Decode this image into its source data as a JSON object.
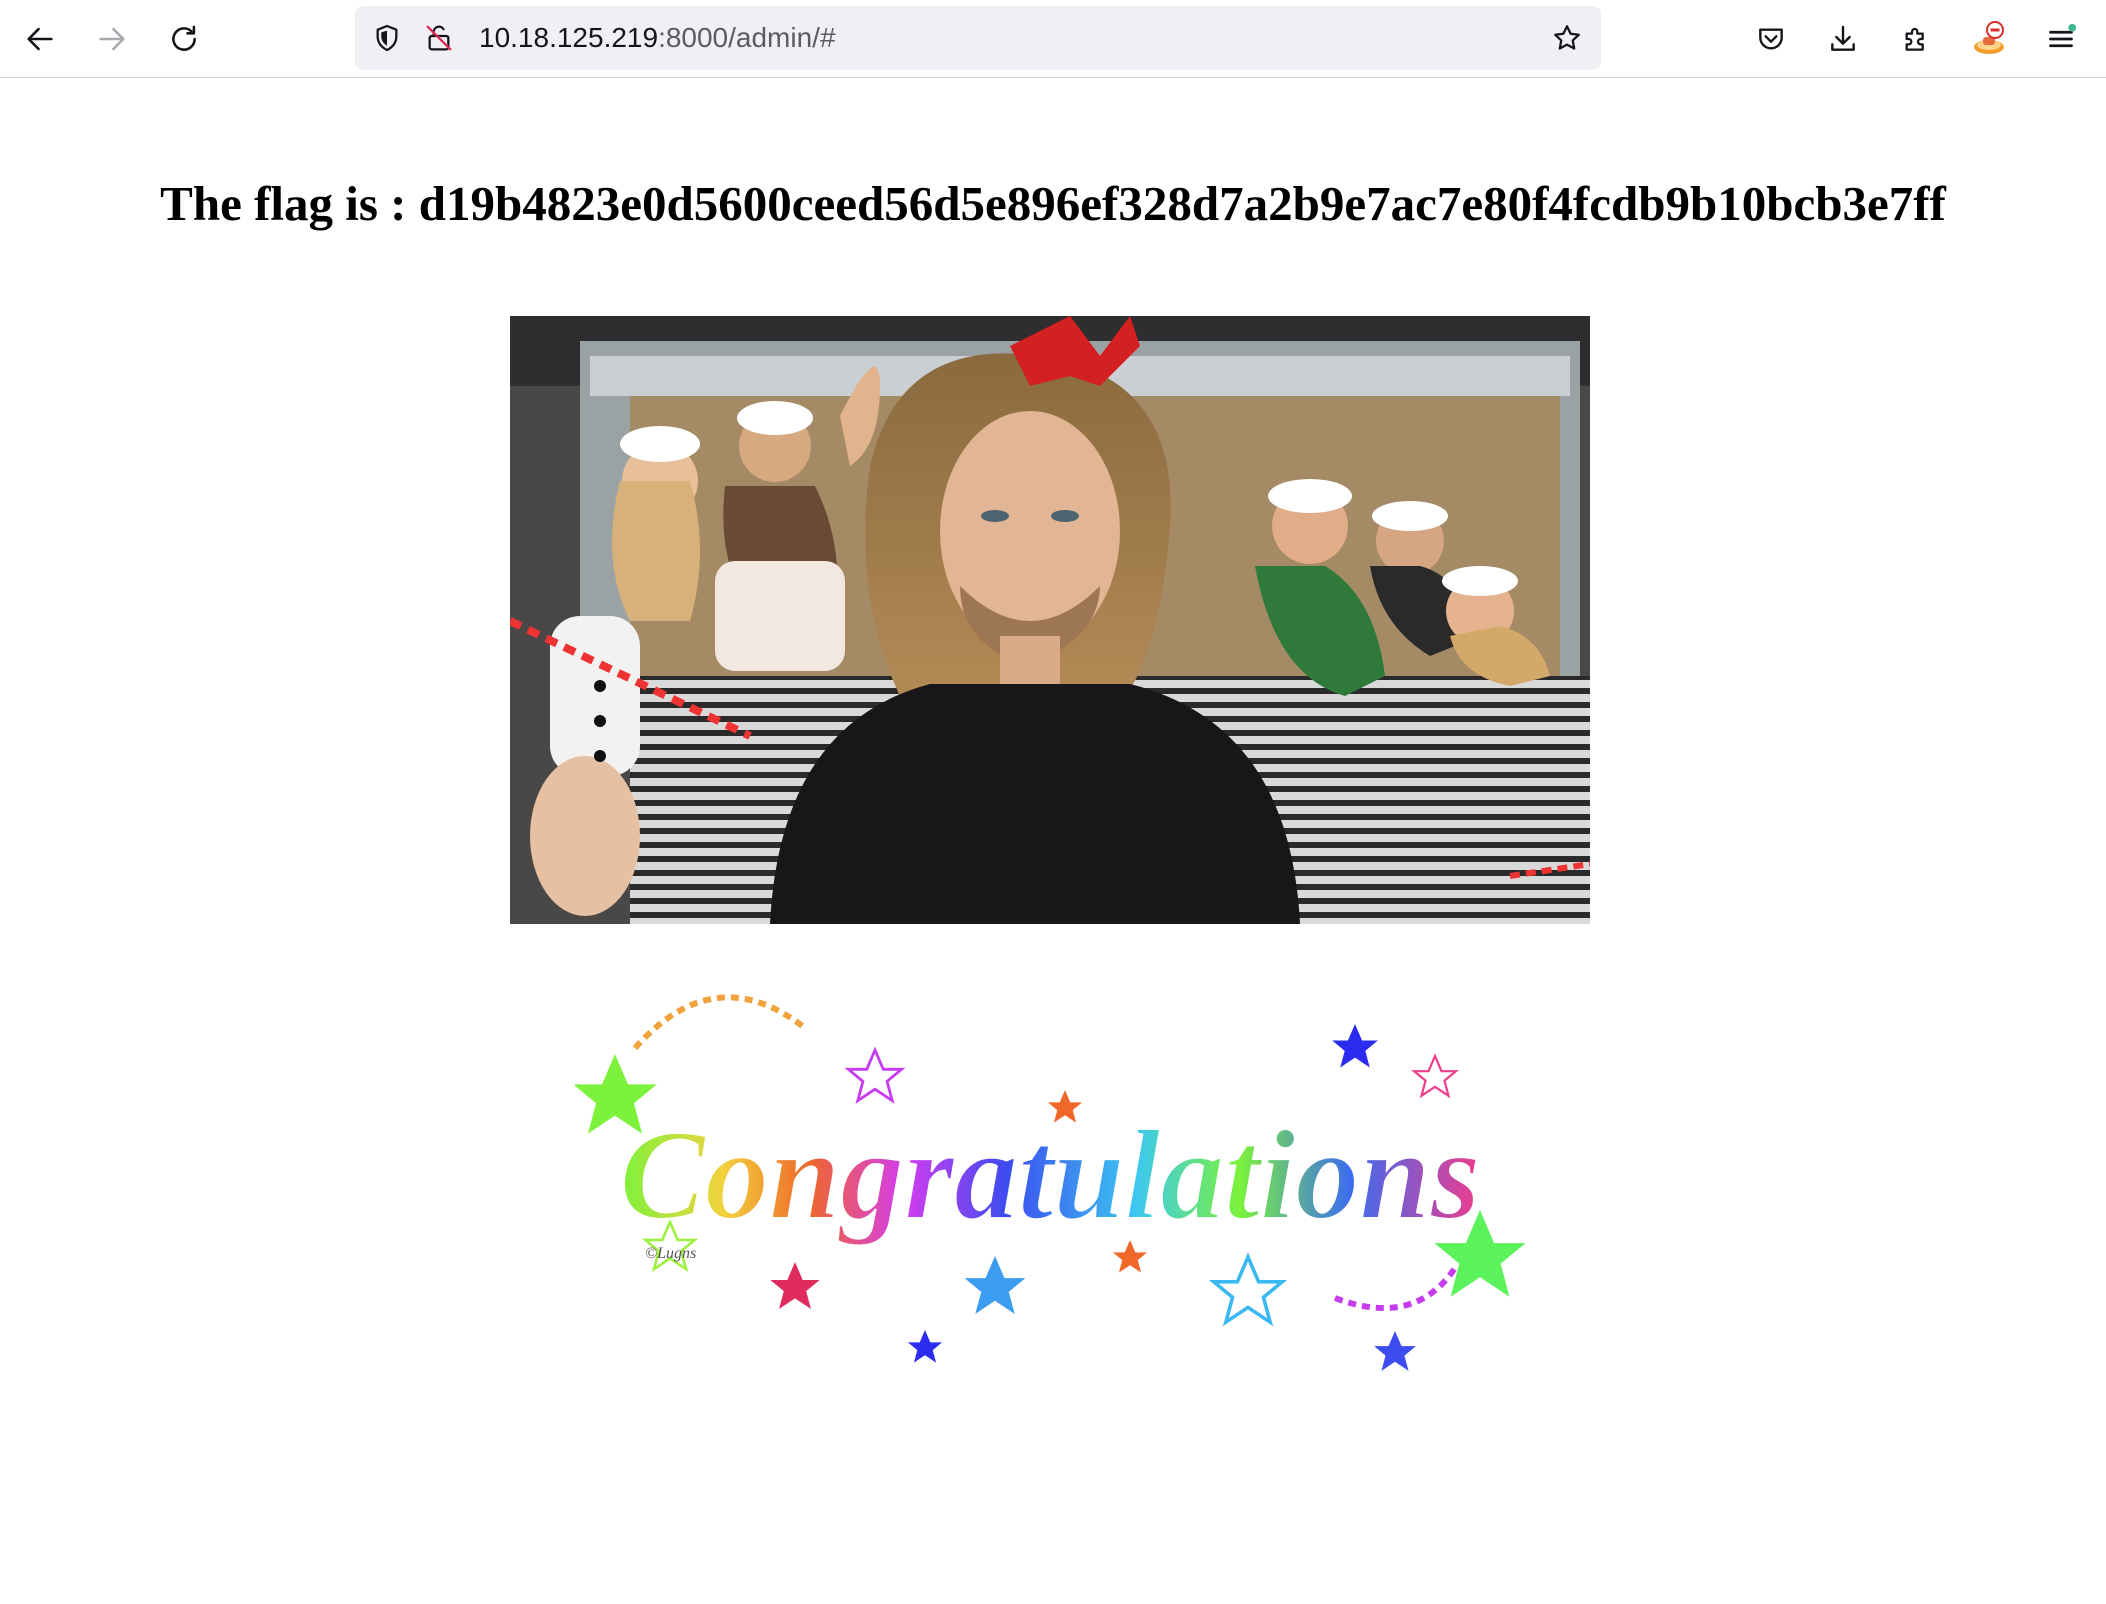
{
  "browser": {
    "url_host": "10.18.125.219",
    "url_rest": ":8000/admin/#",
    "icons": {
      "back": "arrow-left-icon",
      "forward": "arrow-right-icon",
      "reload": "reload-icon",
      "tracking": "shield-icon",
      "insecure": "lock-strikethrough-icon",
      "bookmark": "star-outline-icon",
      "pocket": "pocket-icon",
      "downloads": "download-icon",
      "extensions": "puzzle-icon",
      "account": "account-avatar-icon",
      "menu": "hamburger-menu-icon"
    }
  },
  "page": {
    "flag_text": "The flag is : d19b4823e0d5600ceed56d5e896ef328d7a2b9e7ac7e80f4fcdb9b10bcb3e7ff",
    "congrats_word": "Congratulations",
    "congrats_signature": "©Lugns"
  }
}
